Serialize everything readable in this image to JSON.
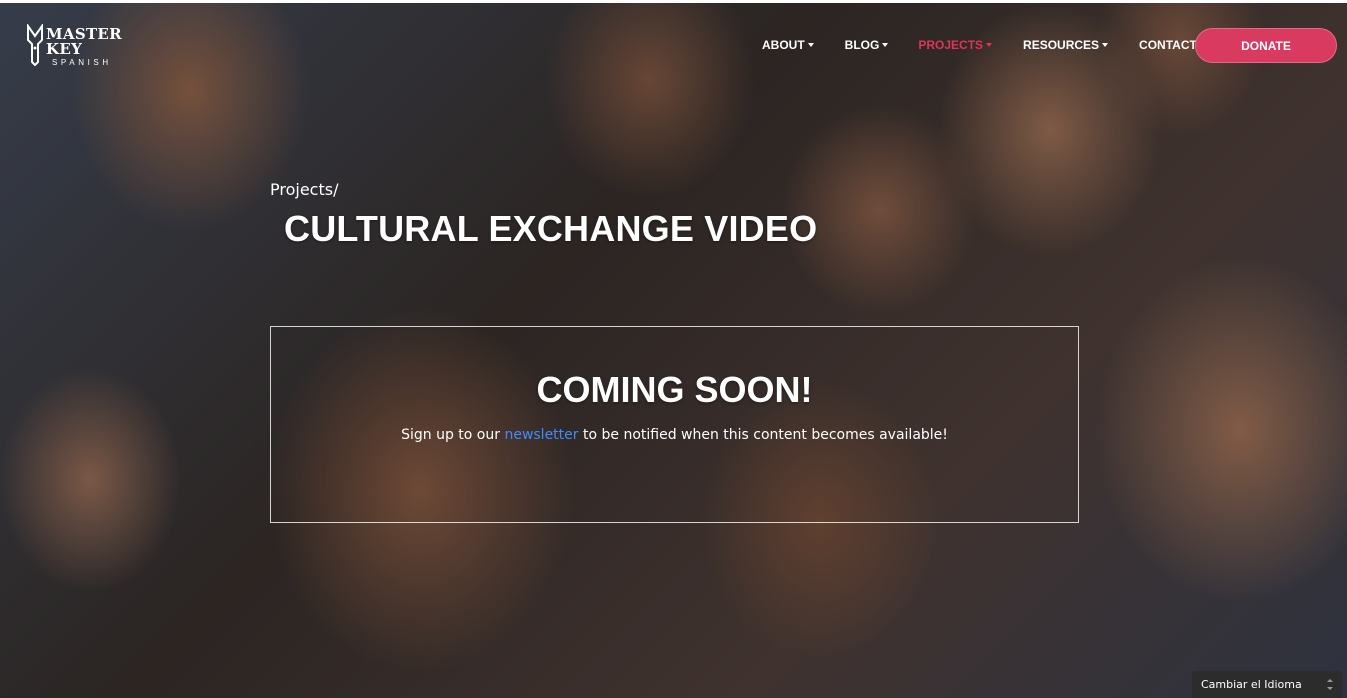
{
  "header": {
    "logo": {
      "main": "MASTER KEY",
      "sub": "SPANISH"
    },
    "nav": [
      {
        "label": "ABOUT",
        "has_dropdown": true,
        "active": false
      },
      {
        "label": "BLOG",
        "has_dropdown": true,
        "active": false
      },
      {
        "label": "PROJECTS",
        "has_dropdown": true,
        "active": true
      },
      {
        "label": "RESOURCES",
        "has_dropdown": true,
        "active": false
      },
      {
        "label": "CONTACT",
        "has_dropdown": false,
        "active": false
      }
    ],
    "donate_label": "DONATE"
  },
  "hero": {
    "breadcrumb": "Projects/",
    "title": "CULTURAL EXCHANGE VIDEO"
  },
  "coming_soon": {
    "title": "COMING SOON!",
    "text_before": "Sign up to our ",
    "link_text": "newsletter",
    "text_after": " to be notified when this content becomes available!"
  },
  "language_select": {
    "selected": "Cambiar el Idioma"
  },
  "colors": {
    "accent": "#d93a60",
    "active_nav": "#e0325a",
    "link": "#3d8dff"
  },
  "icons": {
    "logo": "key-logo-icon",
    "dropdown": "caret-down-icon",
    "select": "select-arrows-icon"
  }
}
